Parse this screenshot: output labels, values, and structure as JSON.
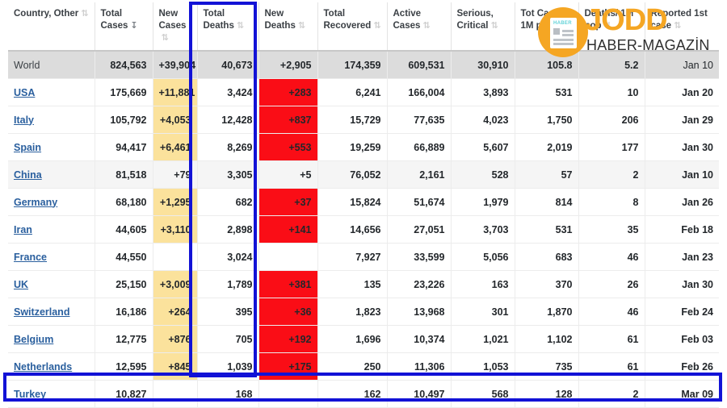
{
  "table": {
    "columns": [
      {
        "label": "Country, Other",
        "sort": "none",
        "align": "left"
      },
      {
        "label": "Total Cases",
        "sort": "desc",
        "align": "right"
      },
      {
        "label": "New Cases",
        "sort": "none",
        "align": "right"
      },
      {
        "label": "Total Deaths",
        "sort": "none",
        "align": "right"
      },
      {
        "label": "New Deaths",
        "sort": "none",
        "align": "right"
      },
      {
        "label": "Total Recovered",
        "sort": "none",
        "align": "right"
      },
      {
        "label": "Active Cases",
        "sort": "none",
        "align": "right"
      },
      {
        "label": "Serious, Critical",
        "sort": "none",
        "align": "right"
      },
      {
        "label": "Tot Cases/ 1M pop",
        "sort": "none",
        "align": "right"
      },
      {
        "label": "Deaths/ 1M pop",
        "sort": "none",
        "align": "right"
      },
      {
        "label": "Reported 1st case",
        "sort": "none",
        "align": "right"
      }
    ],
    "sort_icon_glyph": "⇅",
    "sort_icon_desc_glyph": "↧",
    "rows": [
      {
        "country": "World",
        "is_world": true,
        "link": false,
        "total_cases": "824,563",
        "new_cases": "+39,904",
        "total_deaths": "40,673",
        "new_deaths": "+2,905",
        "total_recovered": "174,359",
        "active_cases": "609,531",
        "serious_critical": "30,910",
        "cases_per_1m": "105.8",
        "deaths_per_1m": "5.2",
        "first_case": "Jan 10"
      },
      {
        "country": "USA",
        "link": true,
        "total_cases": "175,669",
        "new_cases": "+11,881",
        "total_deaths": "3,424",
        "new_deaths": "+283",
        "total_recovered": "6,241",
        "active_cases": "166,004",
        "serious_critical": "3,893",
        "cases_per_1m": "531",
        "deaths_per_1m": "10",
        "first_case": "Jan 20"
      },
      {
        "country": "Italy",
        "link": true,
        "total_cases": "105,792",
        "new_cases": "+4,053",
        "total_deaths": "12,428",
        "new_deaths": "+837",
        "total_recovered": "15,729",
        "active_cases": "77,635",
        "serious_critical": "4,023",
        "cases_per_1m": "1,750",
        "deaths_per_1m": "206",
        "first_case": "Jan 29"
      },
      {
        "country": "Spain",
        "link": true,
        "total_cases": "94,417",
        "new_cases": "+6,461",
        "total_deaths": "8,269",
        "new_deaths": "+553",
        "total_recovered": "19,259",
        "active_cases": "66,889",
        "serious_critical": "5,607",
        "cases_per_1m": "2,019",
        "deaths_per_1m": "177",
        "first_case": "Jan 30"
      },
      {
        "country": "China",
        "link": true,
        "alt": true,
        "total_cases": "81,518",
        "new_cases": "+79",
        "total_deaths": "3,305",
        "new_deaths": "+5",
        "total_recovered": "76,052",
        "active_cases": "2,161",
        "serious_critical": "528",
        "cases_per_1m": "57",
        "deaths_per_1m": "2",
        "first_case": "Jan 10"
      },
      {
        "country": "Germany",
        "link": true,
        "total_cases": "68,180",
        "new_cases": "+1,295",
        "total_deaths": "682",
        "new_deaths": "+37",
        "total_recovered": "15,824",
        "active_cases": "51,674",
        "serious_critical": "1,979",
        "cases_per_1m": "814",
        "deaths_per_1m": "8",
        "first_case": "Jan 26"
      },
      {
        "country": "Iran",
        "link": true,
        "total_cases": "44,605",
        "new_cases": "+3,110",
        "total_deaths": "2,898",
        "new_deaths": "+141",
        "total_recovered": "14,656",
        "active_cases": "27,051",
        "serious_critical": "3,703",
        "cases_per_1m": "531",
        "deaths_per_1m": "35",
        "first_case": "Feb 18"
      },
      {
        "country": "France",
        "link": true,
        "total_cases": "44,550",
        "new_cases": "",
        "total_deaths": "3,024",
        "new_deaths": "",
        "total_recovered": "7,927",
        "active_cases": "33,599",
        "serious_critical": "5,056",
        "cases_per_1m": "683",
        "deaths_per_1m": "46",
        "first_case": "Jan 23"
      },
      {
        "country": "UK",
        "link": true,
        "total_cases": "25,150",
        "new_cases": "+3,009",
        "total_deaths": "1,789",
        "new_deaths": "+381",
        "total_recovered": "135",
        "active_cases": "23,226",
        "serious_critical": "163",
        "cases_per_1m": "370",
        "deaths_per_1m": "26",
        "first_case": "Jan 30"
      },
      {
        "country": "Switzerland",
        "link": true,
        "total_cases": "16,186",
        "new_cases": "+264",
        "total_deaths": "395",
        "new_deaths": "+36",
        "total_recovered": "1,823",
        "active_cases": "13,968",
        "serious_critical": "301",
        "cases_per_1m": "1,870",
        "deaths_per_1m": "46",
        "first_case": "Feb 24"
      },
      {
        "country": "Belgium",
        "link": true,
        "total_cases": "12,775",
        "new_cases": "+876",
        "total_deaths": "705",
        "new_deaths": "+192",
        "total_recovered": "1,696",
        "active_cases": "10,374",
        "serious_critical": "1,021",
        "cases_per_1m": "1,102",
        "deaths_per_1m": "61",
        "first_case": "Feb 03"
      },
      {
        "country": "Netherlands",
        "link": true,
        "total_cases": "12,595",
        "new_cases": "+845",
        "total_deaths": "1,039",
        "new_deaths": "+175",
        "total_recovered": "250",
        "active_cases": "11,306",
        "serious_critical": "1,053",
        "cases_per_1m": "735",
        "deaths_per_1m": "61",
        "first_case": "Feb 26"
      },
      {
        "country": "Turkey",
        "link": true,
        "highlighted": true,
        "total_cases": "10,827",
        "new_cases": "",
        "total_deaths": "168",
        "new_deaths": "",
        "total_recovered": "162",
        "active_cases": "10,497",
        "serious_critical": "568",
        "cases_per_1m": "128",
        "deaths_per_1m": "2",
        "first_case": "Mar 09"
      }
    ]
  },
  "highlights": {
    "color": "#1212d6",
    "column_highlight": "Total Deaths",
    "row_highlight": "Turkey"
  },
  "watermark": {
    "brand": "JODD",
    "tagline": "HABER-MAGAZİN",
    "badge_text": "HABER",
    "badge_color": "#f5a623"
  },
  "colors": {
    "new_cases_cell": "#fbe29c",
    "new_deaths_cell": "#fa0d16",
    "world_row": "#dcdcdc",
    "link": "#2a5f9e"
  }
}
